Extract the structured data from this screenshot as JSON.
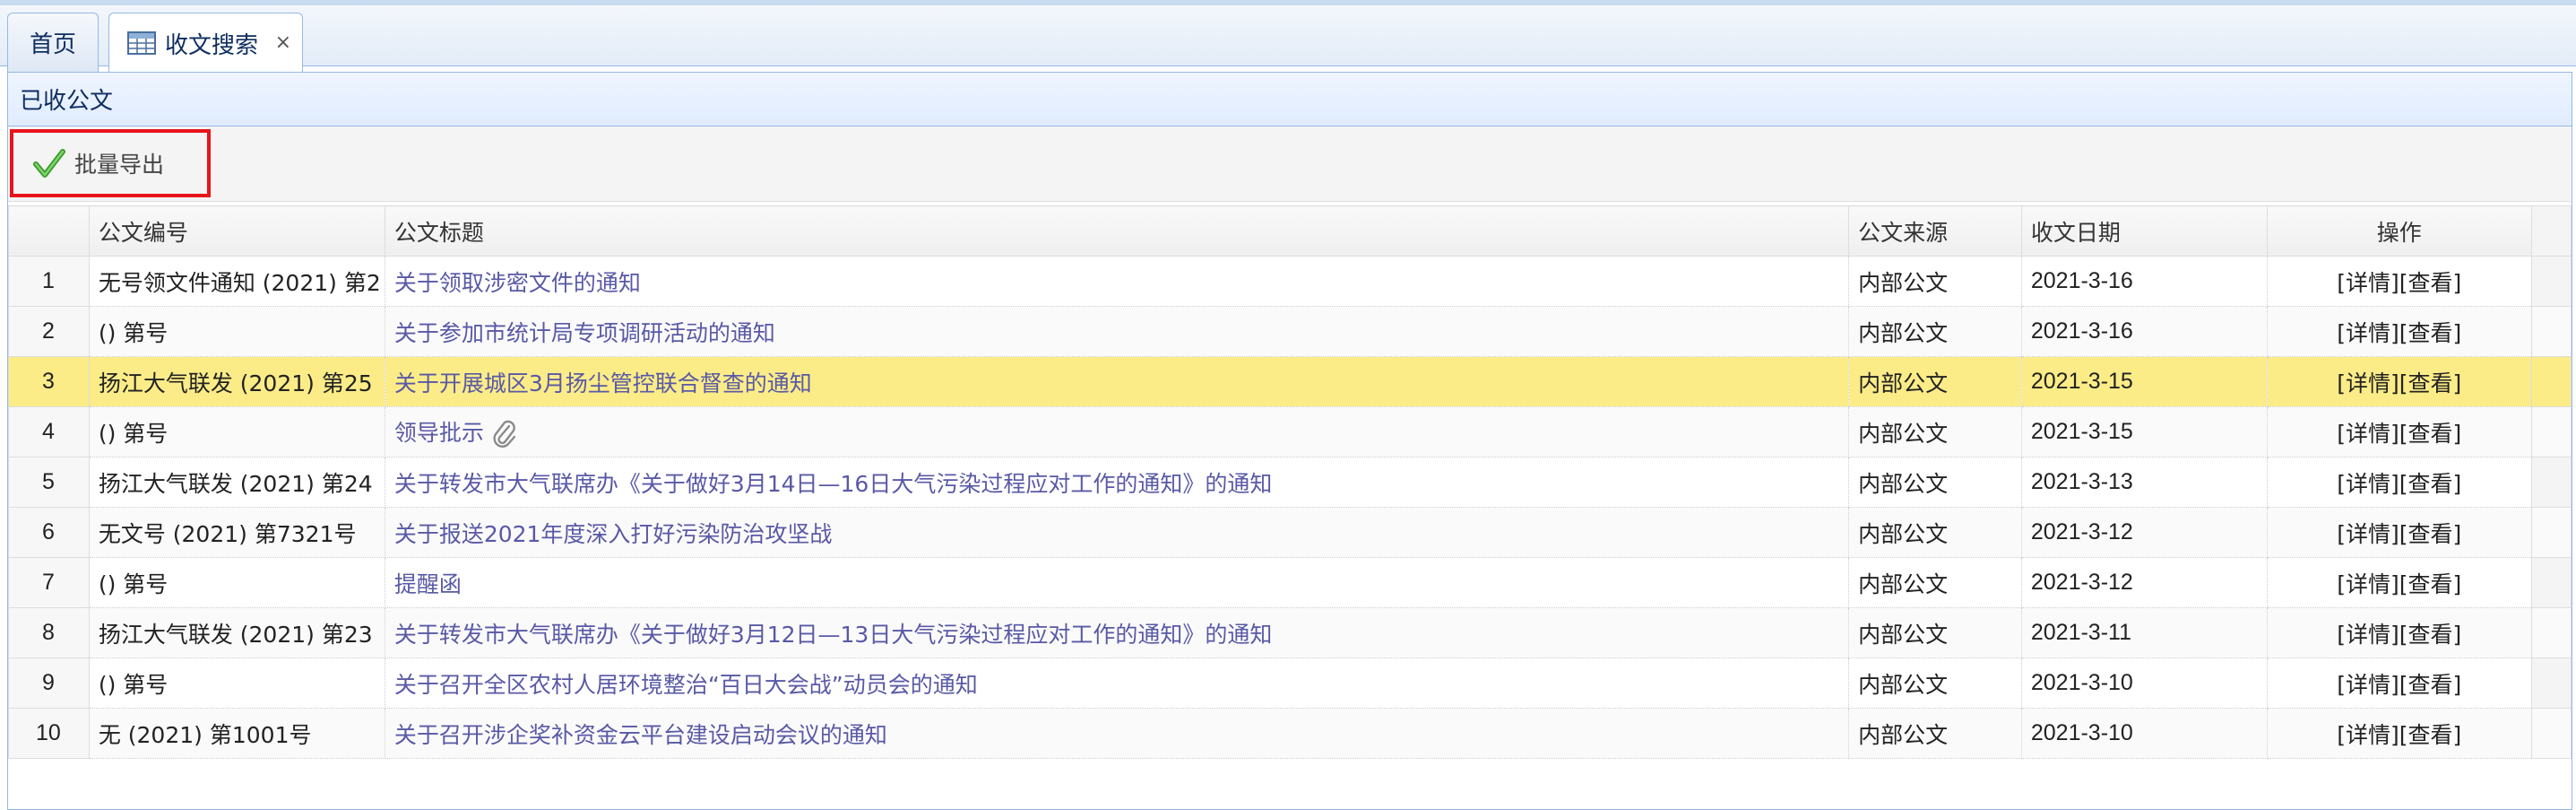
{
  "tabs": [
    {
      "label": "首页",
      "active": false
    },
    {
      "label": "收文搜索",
      "active": true,
      "icon": "table-icon",
      "closable": true
    }
  ],
  "panel": {
    "title": "已收公文"
  },
  "toolbar": {
    "export_label": "批量导出",
    "export_icon": "check-icon"
  },
  "table": {
    "columns": [
      "公文编号",
      "公文标题",
      "公文来源",
      "收文日期",
      "操作"
    ],
    "rows": [
      {
        "no": "1",
        "code": "无号领文件通知 (2021) 第2",
        "title": "关于领取涉密文件的通知",
        "source": "内部公文",
        "date": "2021-3-16",
        "detail": "[详情]",
        "view": "[查看]"
      },
      {
        "no": "2",
        "code": "() 第号",
        "title": "关于参加市统计局专项调研活动的通知",
        "source": "内部公文",
        "date": "2021-3-16",
        "detail": "[详情]",
        "view": "[查看]"
      },
      {
        "no": "3",
        "code": "扬江大气联发 (2021) 第25",
        "title": "关于开展城区3月扬尘管控联合督查的通知",
        "source": "内部公文",
        "date": "2021-3-15",
        "detail": "[详情]",
        "view": "[查看]",
        "selected": true
      },
      {
        "no": "4",
        "code": "() 第号",
        "title": "领导批示",
        "source": "内部公文",
        "date": "2021-3-15",
        "detail": "[详情]",
        "view": "[查看]",
        "attachment_icon": "paperclip-icon"
      },
      {
        "no": "5",
        "code": "扬江大气联发 (2021) 第24",
        "title": "关于转发市大气联席办《关于做好3月14日—16日大气污染过程应对工作的通知》的通知",
        "source": "内部公文",
        "date": "2021-3-13",
        "detail": "[详情]",
        "view": "[查看]"
      },
      {
        "no": "6",
        "code": "无文号 (2021) 第7321号",
        "title": "关于报送2021年度深入打好污染防治攻坚战",
        "source": "内部公文",
        "date": "2021-3-12",
        "detail": "[详情]",
        "view": "[查看]"
      },
      {
        "no": "7",
        "code": "() 第号",
        "title": "提醒函",
        "source": "内部公文",
        "date": "2021-3-12",
        "detail": "[详情]",
        "view": "[查看]"
      },
      {
        "no": "8",
        "code": "扬江大气联发 (2021) 第23",
        "title": "关于转发市大气联席办《关于做好3月12日—13日大气污染过程应对工作的通知》的通知",
        "source": "内部公文",
        "date": "2021-3-11",
        "detail": "[详情]",
        "view": "[查看]"
      },
      {
        "no": "9",
        "code": "() 第号",
        "title": "关于召开全区农村人居环境整治“百日大会战”动员会的通知",
        "source": "内部公文",
        "date": "2021-3-10",
        "detail": "[详情]",
        "view": "[查看]"
      },
      {
        "no": "10",
        "code": "无 (2021) 第1001号",
        "title": "关于召开涉企奖补资金云平台建设启动会议的通知",
        "source": "内部公文",
        "date": "2021-3-10",
        "detail": "[详情]",
        "view": "[查看]"
      }
    ]
  },
  "colors": {
    "selected_row": "#fbec88",
    "link": "#5959a6",
    "highlight_border": "#e8141c",
    "header_border": "#95b8e7"
  }
}
